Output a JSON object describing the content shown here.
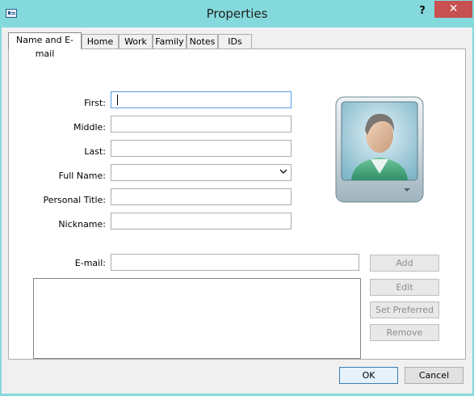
{
  "window": {
    "title": "Properties",
    "help_label": "?",
    "close_label": "✕",
    "titlebar_color": "#84d9dc",
    "close_color": "#c75050"
  },
  "tabs": [
    {
      "label": "Name and E-mail",
      "active": true
    },
    {
      "label": "Home",
      "active": false
    },
    {
      "label": "Work",
      "active": false
    },
    {
      "label": "Family",
      "active": false
    },
    {
      "label": "Notes",
      "active": false
    },
    {
      "label": "IDs",
      "active": false
    }
  ],
  "form": {
    "first_label": "First:",
    "first_value": "",
    "middle_label": "Middle:",
    "middle_value": "",
    "last_label": "Last:",
    "last_value": "",
    "full_name_label": "Full Name:",
    "full_name_value": "",
    "personal_title_label": "Personal Title:",
    "personal_title_value": "",
    "nickname_label": "Nickname:",
    "nickname_value": "",
    "email_label": "E-mail:",
    "email_value": ""
  },
  "email_buttons": {
    "add": "Add",
    "edit": "Edit",
    "set_preferred": "Set Preferred",
    "remove": "Remove"
  },
  "footer": {
    "ok": "OK",
    "cancel": "Cancel"
  },
  "icons": {
    "app": "contact-card-icon",
    "photo": "contact-photo-icon"
  }
}
